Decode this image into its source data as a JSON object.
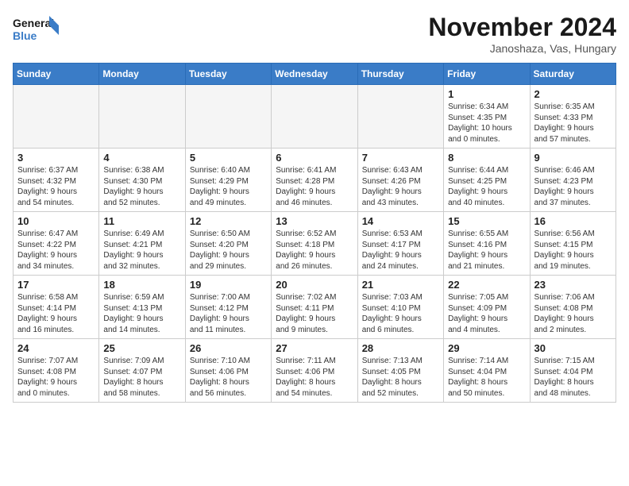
{
  "header": {
    "logo_line1": "General",
    "logo_line2": "Blue",
    "month_title": "November 2024",
    "location": "Janoshaza, Vas, Hungary"
  },
  "weekdays": [
    "Sunday",
    "Monday",
    "Tuesday",
    "Wednesday",
    "Thursday",
    "Friday",
    "Saturday"
  ],
  "weeks": [
    [
      {
        "day": "",
        "info": ""
      },
      {
        "day": "",
        "info": ""
      },
      {
        "day": "",
        "info": ""
      },
      {
        "day": "",
        "info": ""
      },
      {
        "day": "",
        "info": ""
      },
      {
        "day": "1",
        "info": "Sunrise: 6:34 AM\nSunset: 4:35 PM\nDaylight: 10 hours\nand 0 minutes."
      },
      {
        "day": "2",
        "info": "Sunrise: 6:35 AM\nSunset: 4:33 PM\nDaylight: 9 hours\nand 57 minutes."
      }
    ],
    [
      {
        "day": "3",
        "info": "Sunrise: 6:37 AM\nSunset: 4:32 PM\nDaylight: 9 hours\nand 54 minutes."
      },
      {
        "day": "4",
        "info": "Sunrise: 6:38 AM\nSunset: 4:30 PM\nDaylight: 9 hours\nand 52 minutes."
      },
      {
        "day": "5",
        "info": "Sunrise: 6:40 AM\nSunset: 4:29 PM\nDaylight: 9 hours\nand 49 minutes."
      },
      {
        "day": "6",
        "info": "Sunrise: 6:41 AM\nSunset: 4:28 PM\nDaylight: 9 hours\nand 46 minutes."
      },
      {
        "day": "7",
        "info": "Sunrise: 6:43 AM\nSunset: 4:26 PM\nDaylight: 9 hours\nand 43 minutes."
      },
      {
        "day": "8",
        "info": "Sunrise: 6:44 AM\nSunset: 4:25 PM\nDaylight: 9 hours\nand 40 minutes."
      },
      {
        "day": "9",
        "info": "Sunrise: 6:46 AM\nSunset: 4:23 PM\nDaylight: 9 hours\nand 37 minutes."
      }
    ],
    [
      {
        "day": "10",
        "info": "Sunrise: 6:47 AM\nSunset: 4:22 PM\nDaylight: 9 hours\nand 34 minutes."
      },
      {
        "day": "11",
        "info": "Sunrise: 6:49 AM\nSunset: 4:21 PM\nDaylight: 9 hours\nand 32 minutes."
      },
      {
        "day": "12",
        "info": "Sunrise: 6:50 AM\nSunset: 4:20 PM\nDaylight: 9 hours\nand 29 minutes."
      },
      {
        "day": "13",
        "info": "Sunrise: 6:52 AM\nSunset: 4:18 PM\nDaylight: 9 hours\nand 26 minutes."
      },
      {
        "day": "14",
        "info": "Sunrise: 6:53 AM\nSunset: 4:17 PM\nDaylight: 9 hours\nand 24 minutes."
      },
      {
        "day": "15",
        "info": "Sunrise: 6:55 AM\nSunset: 4:16 PM\nDaylight: 9 hours\nand 21 minutes."
      },
      {
        "day": "16",
        "info": "Sunrise: 6:56 AM\nSunset: 4:15 PM\nDaylight: 9 hours\nand 19 minutes."
      }
    ],
    [
      {
        "day": "17",
        "info": "Sunrise: 6:58 AM\nSunset: 4:14 PM\nDaylight: 9 hours\nand 16 minutes."
      },
      {
        "day": "18",
        "info": "Sunrise: 6:59 AM\nSunset: 4:13 PM\nDaylight: 9 hours\nand 14 minutes."
      },
      {
        "day": "19",
        "info": "Sunrise: 7:00 AM\nSunset: 4:12 PM\nDaylight: 9 hours\nand 11 minutes."
      },
      {
        "day": "20",
        "info": "Sunrise: 7:02 AM\nSunset: 4:11 PM\nDaylight: 9 hours\nand 9 minutes."
      },
      {
        "day": "21",
        "info": "Sunrise: 7:03 AM\nSunset: 4:10 PM\nDaylight: 9 hours\nand 6 minutes."
      },
      {
        "day": "22",
        "info": "Sunrise: 7:05 AM\nSunset: 4:09 PM\nDaylight: 9 hours\nand 4 minutes."
      },
      {
        "day": "23",
        "info": "Sunrise: 7:06 AM\nSunset: 4:08 PM\nDaylight: 9 hours\nand 2 minutes."
      }
    ],
    [
      {
        "day": "24",
        "info": "Sunrise: 7:07 AM\nSunset: 4:08 PM\nDaylight: 9 hours\nand 0 minutes."
      },
      {
        "day": "25",
        "info": "Sunrise: 7:09 AM\nSunset: 4:07 PM\nDaylight: 8 hours\nand 58 minutes."
      },
      {
        "day": "26",
        "info": "Sunrise: 7:10 AM\nSunset: 4:06 PM\nDaylight: 8 hours\nand 56 minutes."
      },
      {
        "day": "27",
        "info": "Sunrise: 7:11 AM\nSunset: 4:06 PM\nDaylight: 8 hours\nand 54 minutes."
      },
      {
        "day": "28",
        "info": "Sunrise: 7:13 AM\nSunset: 4:05 PM\nDaylight: 8 hours\nand 52 minutes."
      },
      {
        "day": "29",
        "info": "Sunrise: 7:14 AM\nSunset: 4:04 PM\nDaylight: 8 hours\nand 50 minutes."
      },
      {
        "day": "30",
        "info": "Sunrise: 7:15 AM\nSunset: 4:04 PM\nDaylight: 8 hours\nand 48 minutes."
      }
    ]
  ]
}
